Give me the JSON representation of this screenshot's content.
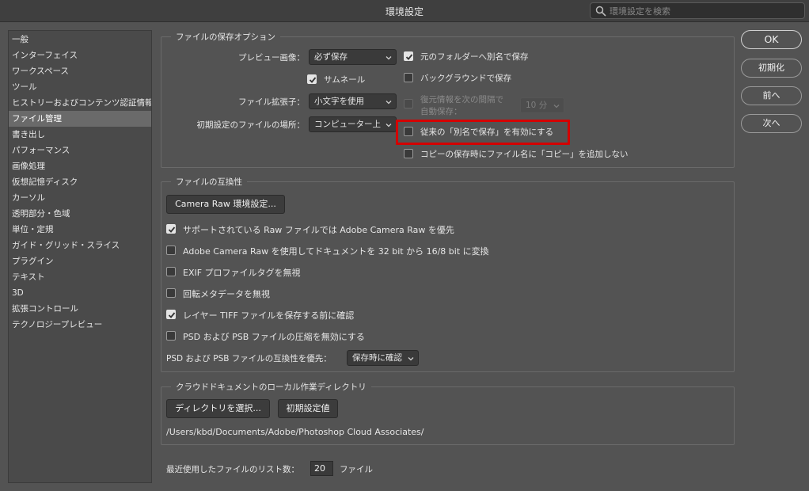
{
  "window": {
    "title": "環境設定"
  },
  "search": {
    "placeholder": "環境設定を検索"
  },
  "sidebar": {
    "items": [
      {
        "label": "一般"
      },
      {
        "label": "インターフェイス"
      },
      {
        "label": "ワークスペース"
      },
      {
        "label": "ツール"
      },
      {
        "label": "ヒストリーおよびコンテンツ認証情報"
      },
      {
        "label": "ファイル管理",
        "active": true
      },
      {
        "label": "書き出し"
      },
      {
        "label": "パフォーマンス"
      },
      {
        "label": "画像処理"
      },
      {
        "label": "仮想記憶ディスク"
      },
      {
        "label": "カーソル"
      },
      {
        "label": "透明部分・色域"
      },
      {
        "label": "単位・定規"
      },
      {
        "label": "ガイド・グリッド・スライス"
      },
      {
        "label": "プラグイン"
      },
      {
        "label": "テキスト"
      },
      {
        "label": "3D"
      },
      {
        "label": "拡張コントロール"
      },
      {
        "label": "テクノロジープレビュー"
      }
    ]
  },
  "save_options": {
    "legend": "ファイルの保存オプション",
    "preview_label": "プレビュー画像：",
    "preview_value": "必ず保存",
    "thumbnail_label": "サムネール",
    "thumbnail_checked": true,
    "extension_label": "ファイル拡張子：",
    "extension_value": "小文字を使用",
    "location_label": "初期設定のファイルの場所：",
    "location_value": "コンピューター上",
    "save_as_original_folder": "元のフォルダーへ別名で保存",
    "save_as_original_folder_checked": true,
    "background_save": "バックグラウンドで保存",
    "background_save_checked": false,
    "auto_save_line1": "復元情報を次の間隔で",
    "auto_save_line2": "自動保存：",
    "auto_save_interval": "10 分",
    "legacy_save_as": "従来の「別名で保存」を有効にする",
    "legacy_save_as_checked": false,
    "no_copy_suffix": "コピーの保存時にファイル名に「コピー」を追加しない",
    "no_copy_suffix_checked": false
  },
  "compat": {
    "legend": "ファイルの互換性",
    "camera_raw_button": "Camera Raw 環境設定...",
    "options": [
      {
        "label": "サポートされている Raw ファイルでは Adobe Camera Raw を優先",
        "checked": true
      },
      {
        "label": "Adobe Camera Raw を使用してドキュメントを 32 bit から 16/8 bit に変換",
        "checked": false
      },
      {
        "label": "EXIF プロファイルタグを無視",
        "checked": false
      },
      {
        "label": "回転メタデータを無視",
        "checked": false
      },
      {
        "label": "レイヤー TIFF ファイルを保存する前に確認",
        "checked": true
      },
      {
        "label": "PSD および PSB ファイルの圧縮を無効にする",
        "checked": false
      }
    ],
    "maximize_label": "PSD および PSB ファイルの互換性を優先：",
    "maximize_value": "保存時に確認"
  },
  "cloud": {
    "legend": "クラウドドキュメントのローカル作業ディレクトリ",
    "choose_button": "ディレクトリを選択...",
    "default_button": "初期設定値",
    "path": "/Users/kbd/Documents/Adobe/Photoshop Cloud Associates/"
  },
  "recent": {
    "label": "最近使用したファイルのリスト数：",
    "value": "20",
    "unit": "ファイル"
  },
  "buttons": {
    "ok": "OK",
    "reset": "初期化",
    "prev": "前へ",
    "next": "次へ"
  }
}
